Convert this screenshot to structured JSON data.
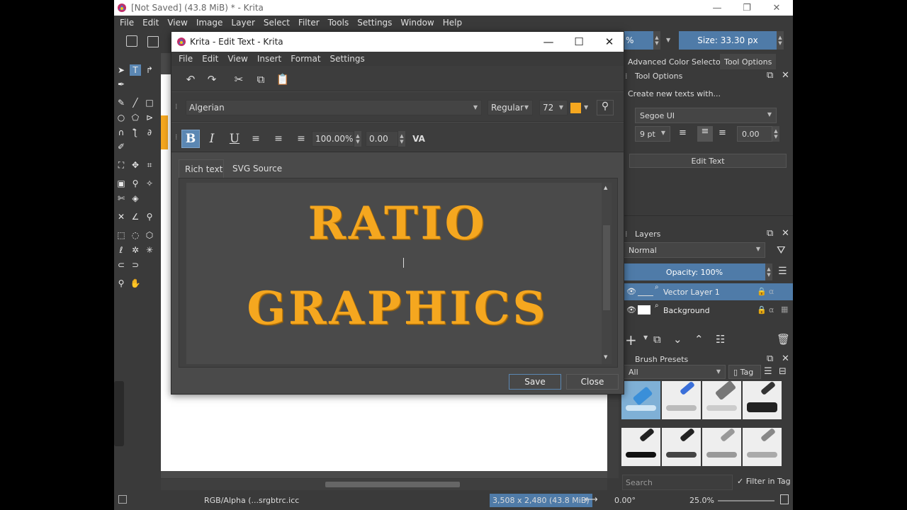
{
  "window": {
    "title": "[Not Saved]  (43.8 MiB)  * - Krita",
    "minimize": "—",
    "restore": "❐",
    "close": "✕"
  },
  "menubar": [
    "File",
    "Edit",
    "View",
    "Image",
    "Layer",
    "Select",
    "Filter",
    "Tools",
    "Settings",
    "Window",
    "Help"
  ],
  "toolbar": {
    "opacity_fragment": "%",
    "size_value": "Size: 33.30 px"
  },
  "docker": {
    "tab_advanced_color": "Advanced Color Selector",
    "tab_tool_options": "Tool Options",
    "tool_options_title": "Tool Options",
    "create_texts_label": "Create new texts with...",
    "font": "Segoe UI",
    "font_size": "9 pt",
    "letter_spacing": "0.00",
    "edit_text_button": "Edit Text",
    "layers_title": "Layers",
    "blend_mode": "Normal",
    "opacity": "Opacity:  100%",
    "layers": [
      {
        "name": "Vector Layer 1",
        "selected": true
      },
      {
        "name": "Background",
        "selected": false
      }
    ],
    "brush_presets_title": "Brush Presets",
    "brush_filter": "All",
    "tag_label": "Tag",
    "search_placeholder": "Search",
    "filter_in_tag": "Filter in Tag"
  },
  "status": {
    "color_profile": "RGB/Alpha (...srgbtrc.icc",
    "dimensions": "3,508 x 2,480 (43.8 MiB)",
    "rotation": "0.00°",
    "zoom": "25.0%"
  },
  "dialog": {
    "title": "Krita - Edit Text - Krita",
    "menu": [
      "File",
      "Edit",
      "View",
      "Insert",
      "Format",
      "Settings"
    ],
    "font_family": "Algerian",
    "font_style": "Regular",
    "font_size": "72",
    "text_color": "#f5a71f",
    "line_height": "100.00%",
    "letter_spacing": "0.00",
    "tab_rich_text": "Rich text",
    "tab_svg_source": "SVG Source",
    "text_line1": "RATIO",
    "text_line2": "GRAPHICS",
    "save_button": "Save",
    "close_button": "Close"
  },
  "colors": {
    "accent": "#4f7ba8",
    "text_orange": "#f5a71f",
    "panel_bg": "#3a3a3a"
  }
}
